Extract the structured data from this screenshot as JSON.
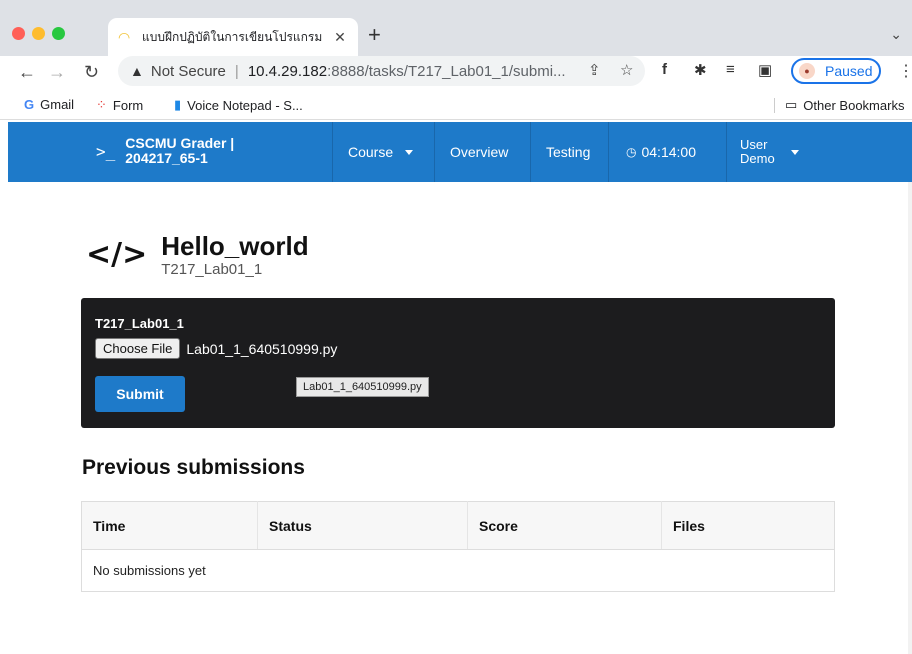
{
  "browser": {
    "tab_title": "แบบฝึกปฏิบัติในการเขียนโปรแกรม",
    "new_tab_symbol": "+",
    "address": {
      "security_label": "Not Secure",
      "host": "10.4.29.182",
      "path": ":8888/tasks/T217_Lab01_1/submi..."
    },
    "profile_button": "Paused",
    "bookmarks": [
      "Gmail",
      "Form",
      "Voice Notepad - S..."
    ],
    "other_bookmarks": "Other Bookmarks"
  },
  "app": {
    "brand_line1": "CSCMU Grader |",
    "brand_line2": "204217_65-1",
    "nav": {
      "course": "Course",
      "overview": "Overview",
      "testing": "Testing",
      "timer": "04:14:00",
      "user_line1": "User",
      "user_line2": "Demo"
    }
  },
  "task": {
    "title": "Hello_world",
    "code": "T217_Lab01_1"
  },
  "upload": {
    "label": "T217_Lab01_1",
    "choose_button": "Choose File",
    "selected_file": "Lab01_1_640510999.py",
    "submit_button": "Submit",
    "tooltip": "Lab01_1_640510999.py"
  },
  "submissions": {
    "heading": "Previous submissions",
    "columns": [
      "Time",
      "Status",
      "Score",
      "Files"
    ],
    "empty_message": "No submissions yet"
  }
}
